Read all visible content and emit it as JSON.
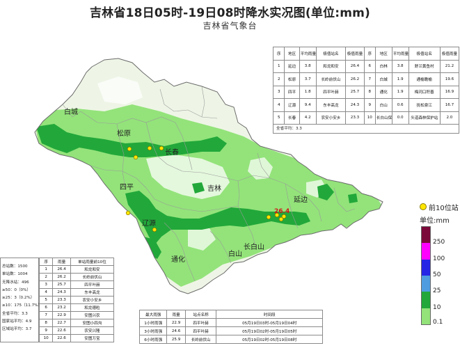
{
  "header": {
    "title": "吉林省18日05时-19日08时降水实况图(单位:mm)",
    "subtitle": "吉林省气象台"
  },
  "map": {
    "regions": [
      {
        "id": "baicheng",
        "name": "白城"
      },
      {
        "id": "songyuan",
        "name": "松原"
      },
      {
        "id": "changchun",
        "name": "长春"
      },
      {
        "id": "siping",
        "name": "四平"
      },
      {
        "id": "jilin",
        "name": "吉林"
      },
      {
        "id": "yanbian",
        "name": "延边"
      },
      {
        "id": "liaoyuan",
        "name": "辽源"
      },
      {
        "id": "baishan",
        "name": "白山"
      },
      {
        "id": "changbaishan",
        "name": "长白山"
      },
      {
        "id": "tonghua",
        "name": "通化"
      }
    ],
    "peak_value": "26.4"
  },
  "legend": {
    "top10_label": "前10位站",
    "top10_marker_color": "#ffe600",
    "unit_label": "单位:mm",
    "ticks": [
      "250",
      "100",
      "50",
      "25",
      "10",
      "0.1"
    ],
    "colors": [
      "#7b0a3a",
      "#ff00ff",
      "#2525e6",
      "#4f9de0",
      "#22a83a",
      "#93e37a"
    ]
  },
  "top_table": {
    "headers": [
      "序",
      "地区",
      "平均雨量",
      "极值站名",
      "极值雨量",
      "序",
      "地区",
      "平均雨量",
      "极值站名",
      "极值雨量"
    ],
    "rows": [
      [
        "1",
        "延边",
        "3.8",
        "和龙和安",
        "26.4",
        "6",
        "白林",
        "3.8",
        "舒兰黄鱼村",
        "21.2"
      ],
      [
        "2",
        "松原",
        "3.7",
        "长岭前伏山",
        "26.2",
        "7",
        "白城",
        "1.9",
        "通榆瞻榆",
        "19.6"
      ],
      [
        "3",
        "四平",
        "1.8",
        "四平叶赫",
        "25.7",
        "8",
        "通化",
        "1.9",
        "梅河口积善",
        "16.9"
      ],
      [
        "4",
        "辽源",
        "9.4",
        "东丰高龙",
        "24.3",
        "9",
        "白山",
        "0.6",
        "抚松泉江",
        "16.7"
      ],
      [
        "5",
        "长春",
        "4.2",
        "农安小安乡",
        "23.3",
        "10",
        "长白山保护区",
        "0.0",
        "头道森林保护站",
        "2.0"
      ]
    ],
    "avg_line": "全省平均：3.3"
  },
  "stats": {
    "lines": [
      "总站数：1500",
      "单站数：1004",
      "无降水站：496",
      "≥50：0（0%）",
      "≥25：3（0.2%）",
      "≥10：175（11.7%）",
      "全省平均：3.3",
      "国家站平均：4.9",
      "区域站平均：3.7"
    ]
  },
  "bottom_table": {
    "headers": [
      "序",
      "雨量",
      "单站雨量前10位"
    ],
    "rows": [
      [
        "1",
        "26.4",
        "和龙和安"
      ],
      [
        "2",
        "26.2",
        "长岭前伏山"
      ],
      [
        "3",
        "25.7",
        "四平叶赫"
      ],
      [
        "4",
        "24.3",
        "东丰高龙"
      ],
      [
        "5",
        "23.3",
        "农安小安乡"
      ],
      [
        "6",
        "23.2",
        "和龙德粒"
      ],
      [
        "7",
        "22.9",
        "安图兴农"
      ],
      [
        "8",
        "22.7",
        "安图小四沟"
      ],
      [
        "9",
        "22.6",
        "农安兴隆"
      ],
      [
        "10",
        "22.6",
        "安图万宝"
      ]
    ]
  },
  "max_table": {
    "headers": [
      "最大雨强",
      "雨量",
      "站点名称",
      "时间段"
    ],
    "rows": [
      [
        "1小时雨强",
        "22.9",
        "四平叶赫",
        "05月19日03时-05月19日04时"
      ],
      [
        "3小时雨强",
        "24.6",
        "四平叶赫",
        "05月19日02时-05月19日05时"
      ],
      [
        "6小时雨强",
        "25.9",
        "长岭前伏山",
        "05月19日02时-05月19日08时"
      ]
    ]
  }
}
